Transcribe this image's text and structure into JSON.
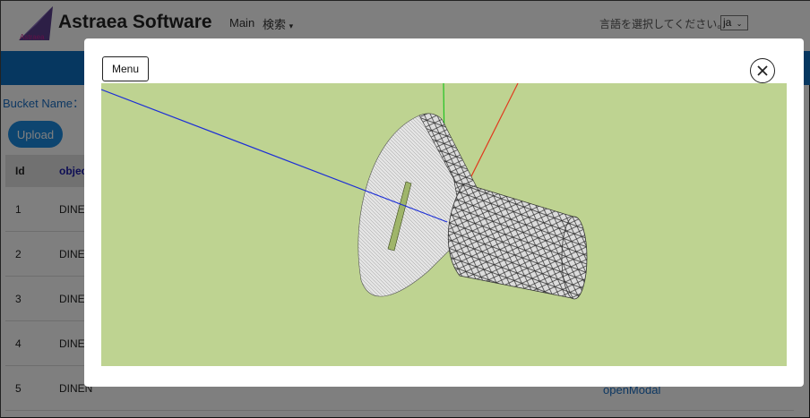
{
  "navbar": {
    "brand": "Astraea Software",
    "logo_text": "Astraea",
    "links": {
      "main": "Main",
      "search": "検索"
    },
    "language_label": "言語を選択してください。",
    "language_value": "ja"
  },
  "page": {
    "bucket_label": "Bucket Name：a",
    "upload_label": "Upload",
    "table": {
      "headers": {
        "id": "Id",
        "object": "object"
      },
      "rows": [
        {
          "id": "1",
          "object": "DINEN"
        },
        {
          "id": "2",
          "object": "DINEN"
        },
        {
          "id": "3",
          "object": "DINEN"
        },
        {
          "id": "4",
          "object": "DINEN"
        },
        {
          "id": "5",
          "object": "DINEN"
        }
      ]
    },
    "open_modal_link": "openModal"
  },
  "modal": {
    "menu_label": "Menu",
    "close_icon": "close-icon",
    "viewer_background": "#bed391",
    "model": "countersunk screw wireframe mesh",
    "axes_colors": {
      "x": "#e03a1e",
      "y": "#22c322",
      "z": "#1d2fd6"
    }
  },
  "colors": {
    "banner": "#0d6fc0",
    "link": "#1a6fc4",
    "upload_button": "#1a8be0"
  }
}
